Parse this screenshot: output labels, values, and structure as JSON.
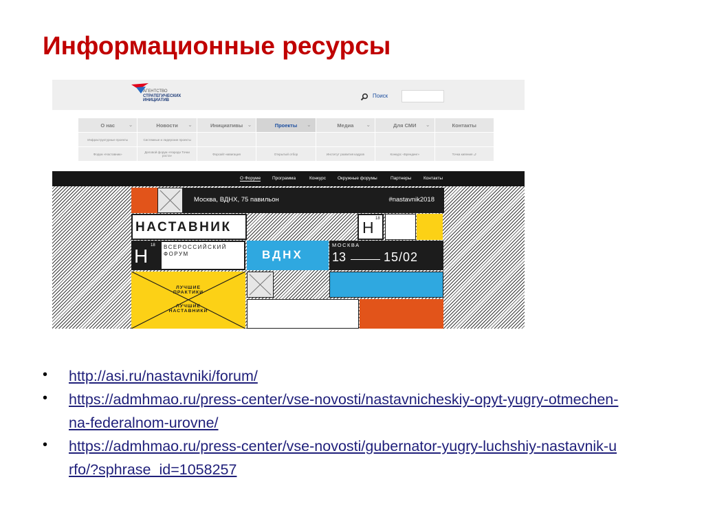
{
  "slide": {
    "title": "Информационные ресурсы",
    "links": [
      "http://asi.ru/nastavniki/forum/",
      "https://admhmao.ru/press-center/vse-novosti/nastavnicheskiy-opyt-yugry-otmechen-na-federalnom-urovne/",
      "https://admhmao.ru/press-center/vse-novosti/gubernator-yugry-luchshiy-nastavnik-urfo/?sphrase_id=1058257"
    ]
  },
  "asi_site": {
    "logo_lines": [
      "АГЕНТСТВО",
      "СТРАТЕГИЧЕСКИХ",
      "ИНИЦИАТИВ"
    ],
    "search_label": "Поиск",
    "menu": [
      "О нас",
      "Новости",
      "Инициативы",
      "Проекты",
      "Медиа",
      "Для СМИ",
      "Контакты"
    ],
    "active_menu": "Проекты",
    "submenu_row1": [
      "Инфраструктурные проекты",
      "Системные и лидерские проекты",
      "",
      "",
      "",
      "",
      ""
    ],
    "submenu_row2": [
      "Форум «Наставник»",
      "Деловой форум «Həродн Точки роста»",
      "Форсайт-навигация",
      "Открытый отбор",
      "Институт развития кадров",
      "Конкурс «Брендинг»",
      "Точка кипения ⮐"
    ]
  },
  "forum": {
    "nav": [
      "О Форуме",
      "Программа",
      "Конкурс",
      "Окружные форумы",
      "Партнеры",
      "Контакты"
    ],
    "location": "Москва, ВДНХ, 75 павильон",
    "hashtag": "#nastavnik2018",
    "name": "НАСТАВНИК",
    "logo_letter": "Н",
    "logo_sup": "18",
    "subtitle_line1": "ВСЕРОССИЙСКИЙ",
    "subtitle_line2": "ФОРУМ",
    "venue": "ВДНХ",
    "city": "МОСКВА",
    "date_start": "13",
    "date_end": "15/02",
    "best_practices": "ЛУЧШИЕ ПРАКТИКИ",
    "best_mentors": "ЛУЧШИЕ НАСТАВНИКИ"
  },
  "colors": {
    "title": "#c00000",
    "link": "#1f1f7a",
    "orange": "#e2541a",
    "yellow": "#fcd116",
    "blue": "#2fa8e0",
    "black": "#1c1c1c"
  }
}
